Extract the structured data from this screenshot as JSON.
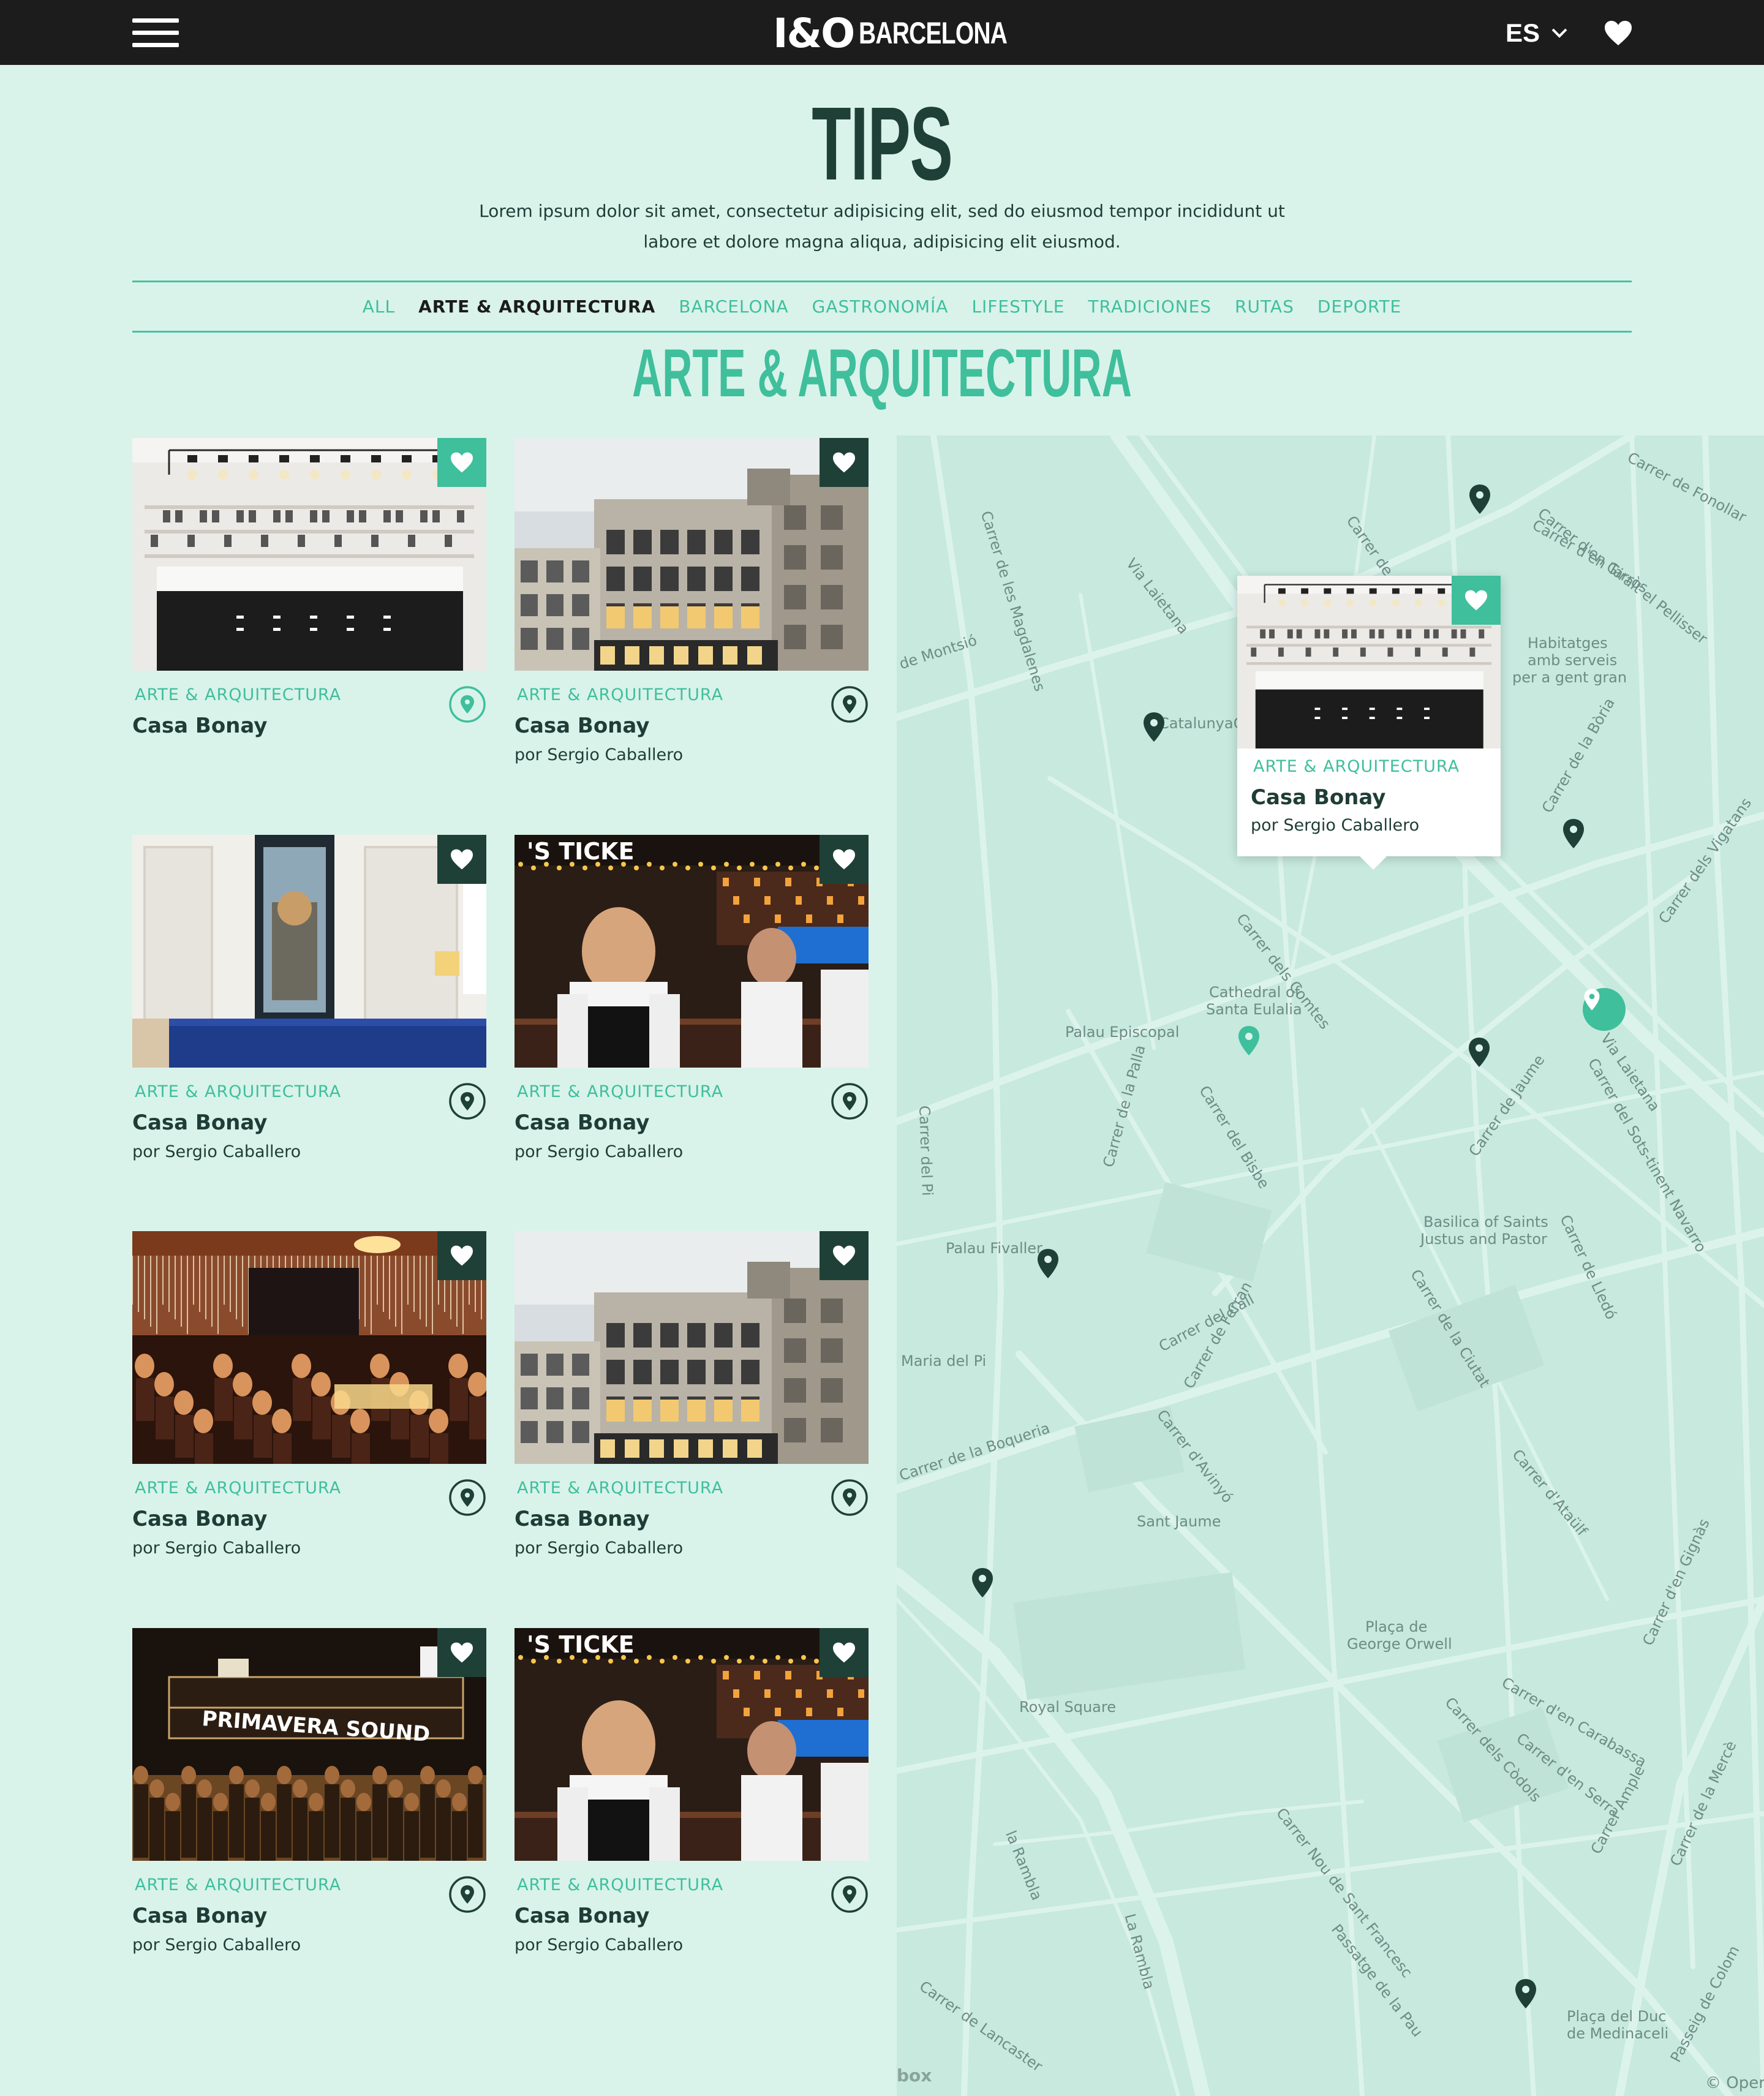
{
  "header": {
    "logo_mark": "I&O",
    "logo_city": "BARCELONA",
    "language": "ES"
  },
  "page": {
    "title": "TIPS",
    "intro": "Lorem ipsum dolor sit amet, consectetur adipisicing elit, sed do eiusmod tempor incididunt ut labore et dolore magna aliqua, adipisicing elit eiusmod."
  },
  "filters": [
    {
      "label": "ALL",
      "active": false
    },
    {
      "label": "ARTE & ARQUITECTURA",
      "active": true
    },
    {
      "label": "BARCELONA",
      "active": false
    },
    {
      "label": "GASTRONOMÍA",
      "active": false
    },
    {
      "label": "LIFESTYLE",
      "active": false
    },
    {
      "label": "TRADICIONES",
      "active": false
    },
    {
      "label": "RUTAS",
      "active": false
    },
    {
      "label": "DEPORTE",
      "active": false
    }
  ],
  "section_title": "ARTE & ARQUITECTURA",
  "cards": [
    {
      "category": "ARTE & ARQUITECTURA",
      "name": "Casa Bonay",
      "author": "",
      "image": "shop-interior",
      "fav_color": "teal",
      "pin_active": true
    },
    {
      "category": "ARTE & ARQUITECTURA",
      "name": "Casa Bonay",
      "author": "por Sergio Caballero",
      "image": "building-facade",
      "fav_color": "dark",
      "pin_active": false
    },
    {
      "category": "ARTE & ARQUITECTURA",
      "name": "Casa Bonay",
      "author": "por Sergio Caballero",
      "image": "hotel-room",
      "fav_color": "dark",
      "pin_active": false
    },
    {
      "category": "ARTE & ARQUITECTURA",
      "name": "Casa Bonay",
      "author": "por Sergio Caballero",
      "image": "chef-kitchen",
      "fav_color": "dark",
      "pin_active": false
    },
    {
      "category": "ARTE & ARQUITECTURA",
      "name": "Casa Bonay",
      "author": "por Sergio Caballero",
      "image": "restaurant-night",
      "fav_color": "dark",
      "pin_active": false
    },
    {
      "category": "ARTE & ARQUITECTURA",
      "name": "Casa Bonay",
      "author": "por Sergio Caballero",
      "image": "building-facade",
      "fav_color": "dark",
      "pin_active": false
    },
    {
      "category": "ARTE & ARQUITECTURA",
      "name": "Casa Bonay",
      "author": "por Sergio Caballero",
      "image": "festival-crowd",
      "fav_color": "dark",
      "pin_active": false
    },
    {
      "category": "ARTE & ARQUITECTURA",
      "name": "Casa Bonay",
      "author": "por Sergio Caballero",
      "image": "chef-kitchen",
      "fav_color": "dark",
      "pin_active": false
    }
  ],
  "image_texts": {
    "ticket_sign": "TICKE",
    "ticket_prefix": "'S",
    "festival_sign": "PRIMAVERA SOUND"
  },
  "map": {
    "labels": [
      "Carrer de Fonollar",
      "Carrer de les Magdalenes",
      "Via Laietana",
      "Carrer de la",
      "Carrer d'en Tarròs",
      "Carrer d'en Giralt el Pellisser",
      "Habitatges",
      "amb serveis",
      "per a gent gran",
      "de Montsió",
      "CatalunyaC",
      "Carrer de la Bòria",
      "Carrer dels Comtes",
      "Cathedral of",
      "Santa Eulalia",
      "Palau Episcopal",
      "Carrer dels Vigatans",
      "Via Laietana",
      "Carrer del Sots-tinent Navarro",
      "Carrer de Jaume",
      "Carrer del Bisbe",
      "Carrer de la Palla",
      "Carrer del Pi",
      "Basilica of Saints",
      "Justus and Pastor",
      "Carrer de Lledó",
      "Carrer de la Ciutat",
      "Palau Fivaller",
      "Carrer del Call",
      "Carrer de Ferran",
      "Maria del Pi",
      "Carrer de la Boqueria",
      "Carrer d'Avinyó",
      "Carrer d'Ataülf",
      "Sant Jaume",
      "Carrer d'en Gignàs",
      "Plaça de",
      "George Orwell",
      "Royal Square",
      "Carrer d'en Carabassa",
      "Carrer dels Còdols",
      "Carrer d'en Serra",
      "Carrer Nou de Sant Francesc",
      "Carrer Ample",
      "Carrer de la Mercè",
      "la Rambla",
      "La Rambla",
      "Passatge de la Pau",
      "Carrer de Lancaster",
      "Plaça del Duc",
      "de Medinaceli",
      "Passeig de Colom"
    ],
    "popup": {
      "category": "ARTE & ARQUITECTURA",
      "name": "Casa Bonay",
      "author": "por Sergio Caballero"
    },
    "credit_left": "box",
    "credit_right": "© Oper"
  },
  "colors": {
    "accent": "#3fbf9c",
    "dark": "#1f4037",
    "background": "#d9f3ea",
    "topbar": "#1c1c1c",
    "map": "#c7e9de"
  },
  "icons": [
    "menu-icon",
    "chevron-down-icon",
    "heart-icon",
    "map-pin-icon"
  ]
}
